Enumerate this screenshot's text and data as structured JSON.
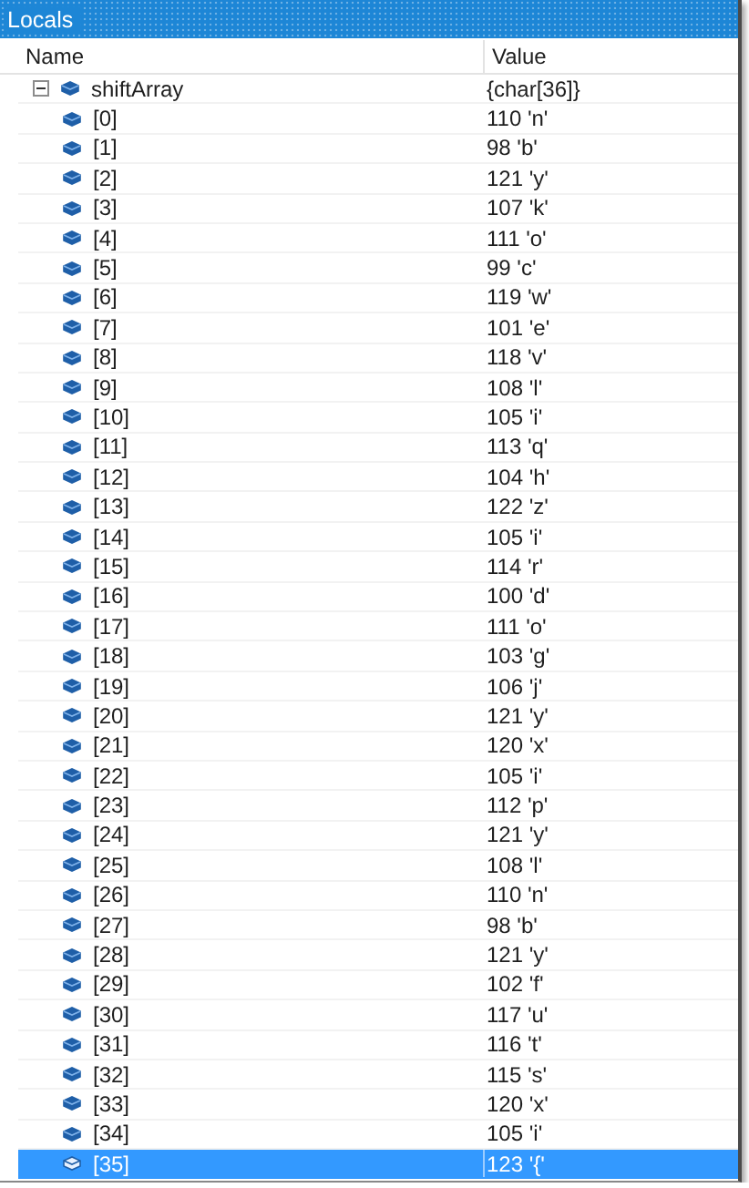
{
  "panel": {
    "title": "Locals"
  },
  "columns": [
    "Name",
    "Value"
  ],
  "rows": [
    {
      "name": "shiftArray",
      "value": "{char[36]}",
      "expanded": true,
      "selected": false,
      "children": [
        {
          "name": "[0]",
          "value": "110 'n'",
          "selected": false
        },
        {
          "name": "[1]",
          "value": "98 'b'",
          "selected": false
        },
        {
          "name": "[2]",
          "value": "121 'y'",
          "selected": false
        },
        {
          "name": "[3]",
          "value": "107 'k'",
          "selected": false
        },
        {
          "name": "[4]",
          "value": "111 'o'",
          "selected": false
        },
        {
          "name": "[5]",
          "value": "99 'c'",
          "selected": false
        },
        {
          "name": "[6]",
          "value": "119 'w'",
          "selected": false
        },
        {
          "name": "[7]",
          "value": "101 'e'",
          "selected": false
        },
        {
          "name": "[8]",
          "value": "118 'v'",
          "selected": false
        },
        {
          "name": "[9]",
          "value": "108 'l'",
          "selected": false
        },
        {
          "name": "[10]",
          "value": "105 'i'",
          "selected": false
        },
        {
          "name": "[11]",
          "value": "113 'q'",
          "selected": false
        },
        {
          "name": "[12]",
          "value": "104 'h'",
          "selected": false
        },
        {
          "name": "[13]",
          "value": "122 'z'",
          "selected": false
        },
        {
          "name": "[14]",
          "value": "105 'i'",
          "selected": false
        },
        {
          "name": "[15]",
          "value": "114 'r'",
          "selected": false
        },
        {
          "name": "[16]",
          "value": "100 'd'",
          "selected": false
        },
        {
          "name": "[17]",
          "value": "111 'o'",
          "selected": false
        },
        {
          "name": "[18]",
          "value": "103 'g'",
          "selected": false
        },
        {
          "name": "[19]",
          "value": "106 'j'",
          "selected": false
        },
        {
          "name": "[20]",
          "value": "121 'y'",
          "selected": false
        },
        {
          "name": "[21]",
          "value": "120 'x'",
          "selected": false
        },
        {
          "name": "[22]",
          "value": "105 'i'",
          "selected": false
        },
        {
          "name": "[23]",
          "value": "112 'p'",
          "selected": false
        },
        {
          "name": "[24]",
          "value": "121 'y'",
          "selected": false
        },
        {
          "name": "[25]",
          "value": "108 'l'",
          "selected": false
        },
        {
          "name": "[26]",
          "value": "110 'n'",
          "selected": false
        },
        {
          "name": "[27]",
          "value": "98 'b'",
          "selected": false
        },
        {
          "name": "[28]",
          "value": "121 'y'",
          "selected": false
        },
        {
          "name": "[29]",
          "value": "102 'f'",
          "selected": false
        },
        {
          "name": "[30]",
          "value": "117 'u'",
          "selected": false
        },
        {
          "name": "[31]",
          "value": "116 't'",
          "selected": false
        },
        {
          "name": "[32]",
          "value": "115 's'",
          "selected": false
        },
        {
          "name": "[33]",
          "value": "120 'x'",
          "selected": false
        },
        {
          "name": "[34]",
          "value": "105 'i'",
          "selected": false
        },
        {
          "name": "[35]",
          "value": "123 '{'",
          "selected": true
        }
      ]
    }
  ]
}
